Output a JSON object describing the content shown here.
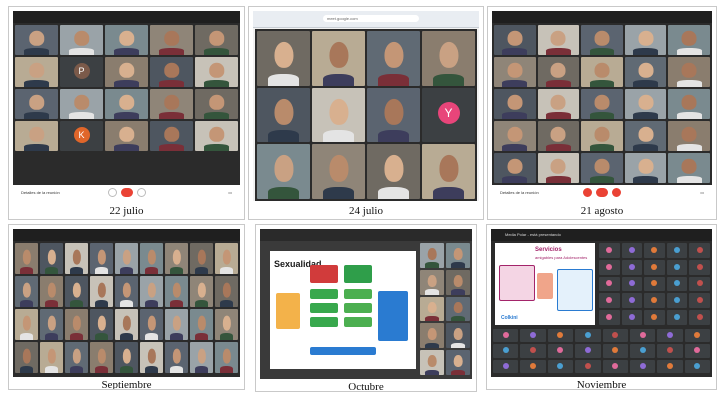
{
  "captions": [
    "22 julio",
    "24 julio",
    "21 agosto",
    "Septiembre",
    "Octubre",
    "Noviembre"
  ],
  "panel1": {
    "letters": [
      "P",
      "K"
    ],
    "footer_left": "Detalles de la reunión"
  },
  "panel2": {
    "url": "meet.google.com",
    "letter": "Y"
  },
  "panel3": {
    "footer_left": "Detalles de la reunión"
  },
  "panel5": {
    "slide_title": "Sexualidad"
  },
  "panel6": {
    "meet_title": "Media Polar - está presentando",
    "slide_title": "Servicios",
    "slide_subtitle": "amigables para Adolescentes",
    "slide_brand": "Colkini"
  },
  "colors": {
    "meet_dark": "#202124",
    "hangup_red": "#ea4335",
    "avatar_brown": "#7b5a4a",
    "avatar_orange": "#e0662a",
    "avatar_pink": "#e8457a",
    "slide_blue": "#2a7bd1"
  }
}
